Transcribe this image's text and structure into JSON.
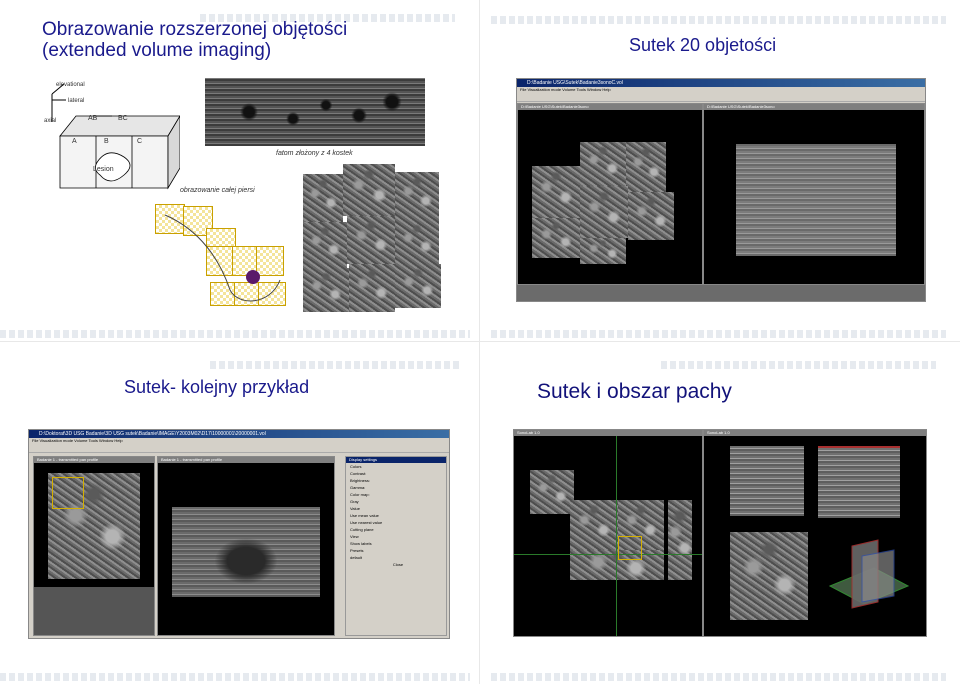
{
  "slides": [
    {
      "title_line1": "Obrazowanie rozszerzonej objętości",
      "title_line2": "(extended volume imaging)",
      "diagram": {
        "elevational": "elevational",
        "lateral": "lateral",
        "axial": "axial",
        "ab": "AB",
        "bc": "BC",
        "a": "A",
        "b": "B",
        "c": "C",
        "lesion": "Lesion"
      },
      "caption_fatom": "fatom złożony z 4 kostek",
      "caption_whole": "obrazowanie całej piersi"
    },
    {
      "title": "Sutek 20 objetości",
      "window_title": "D:\\Badanie USG\\Sutek\\Badanie3sonoC.vol",
      "menu": "File  Visualization mode  Volume  Tools  Window  Help",
      "sub1_title": "D:\\Badanie USG\\Sutek\\Badanie3sono",
      "sub2_title": "D:\\Badanie USG\\Sutek\\Badanie3sono"
    },
    {
      "title": "Sutek- kolejny przykład",
      "window_title": "D:\\Doktorat\\3D USG Badanie\\3D USG sutek\\Badanie\\IMAGE\\Y2003M02\\D17\\10000001\\20000001.vol",
      "menu": "File  Visualization mode  Volume  Tools  Window  Help",
      "sub1_title": "Badanie 1 - transmitted pan profile",
      "sub2_title": "Badanie 1 - transmitted pan profile",
      "dialog": {
        "title": "Display settings",
        "colors": "Colors",
        "contrast": "Contrast:",
        "brightness": "Brightness:",
        "gamma": "Gamma:",
        "colormap": "Color map:",
        "colormap_value": "Gray",
        "value": "Value",
        "use_mean": "Use mean value",
        "use_nearest": "Use nearest value",
        "cutting_plane": "Cutting plane",
        "view": "View",
        "show_labels": "Show labels",
        "presets": "Presets",
        "preset_value": "default",
        "close": "Close"
      }
    },
    {
      "title": "Sutek i obszar pachy",
      "sub1_title": "SonoLab 1.0",
      "sub2_title": "SonoLab 1.0"
    }
  ]
}
